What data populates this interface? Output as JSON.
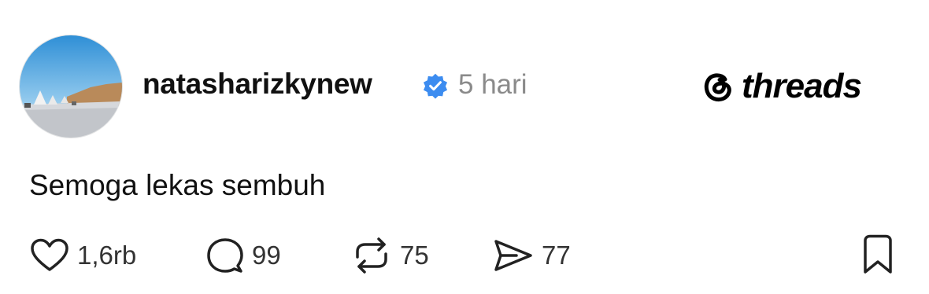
{
  "post": {
    "username": "natasharizkynew",
    "time": "5 hari",
    "text": "Semoga lekas sembuh"
  },
  "brand": {
    "name": "threads"
  },
  "actions": {
    "likes": "1,6rb",
    "replies": "99",
    "reposts": "75",
    "shares": "77"
  },
  "icons": [
    "avatar-image",
    "verified-badge-icon",
    "threads-logo-icon",
    "heart-icon",
    "comment-icon",
    "repost-icon",
    "send-icon",
    "bookmark-icon"
  ],
  "colors": {
    "verified": "#3c8cf0",
    "muted_text": "#8a8a8a"
  }
}
